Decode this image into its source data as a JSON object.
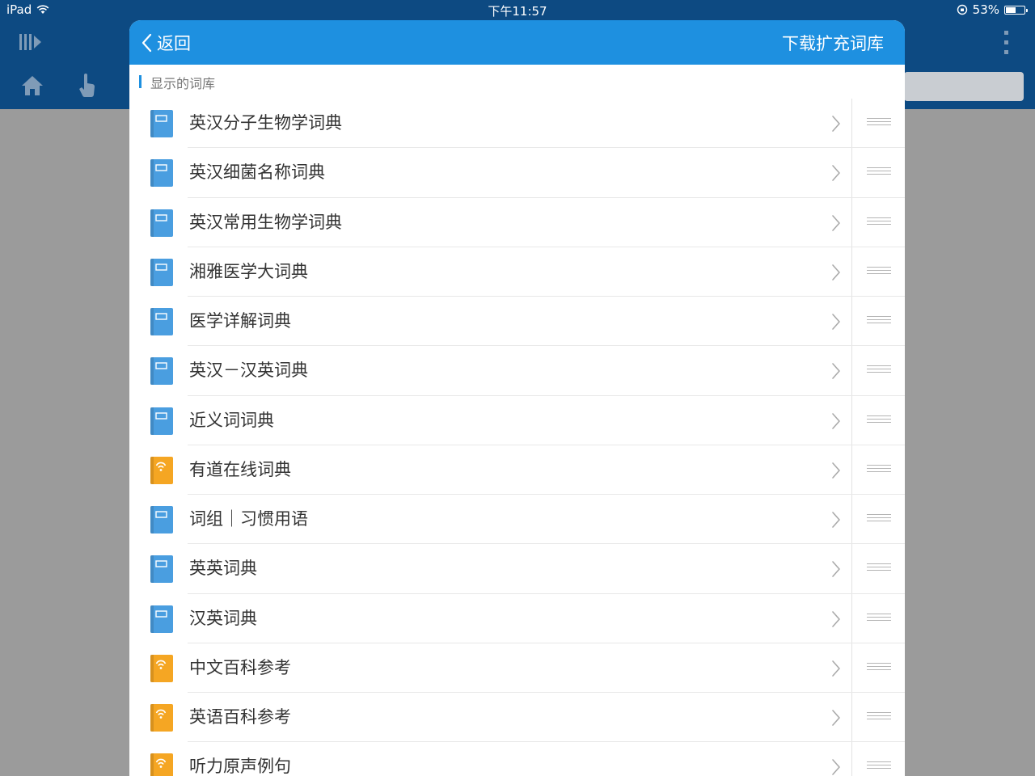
{
  "status_bar": {
    "device": "iPad",
    "time": "下午11:57",
    "battery": "53%",
    "battery_level": 0.53
  },
  "header": {
    "back_label": "返回",
    "action_label": "下载扩充词库"
  },
  "section_title": "显示的词库",
  "colors": {
    "status_bg": "#0d4a82",
    "header_bg": "#1e90e0",
    "offline_book": "#4a9ee0",
    "online_book": "#f5a623"
  },
  "items": [
    {
      "label": "英汉分子生物学词典",
      "type": "offline"
    },
    {
      "label": "英汉细菌名称词典",
      "type": "offline"
    },
    {
      "label": "英汉常用生物学词典",
      "type": "offline"
    },
    {
      "label": "湘雅医学大词典",
      "type": "offline"
    },
    {
      "label": "医学详解词典",
      "type": "offline"
    },
    {
      "label": "英汉－汉英词典",
      "type": "offline"
    },
    {
      "label": "近义词词典",
      "type": "offline"
    },
    {
      "label": "有道在线词典",
      "type": "online"
    },
    {
      "label": "词组｜习惯用语",
      "type": "offline"
    },
    {
      "label": "英英词典",
      "type": "offline"
    },
    {
      "label": "汉英词典",
      "type": "offline"
    },
    {
      "label": "中文百科参考",
      "type": "online"
    },
    {
      "label": "英语百科参考",
      "type": "online"
    },
    {
      "label": "听力原声例句",
      "type": "online"
    }
  ]
}
